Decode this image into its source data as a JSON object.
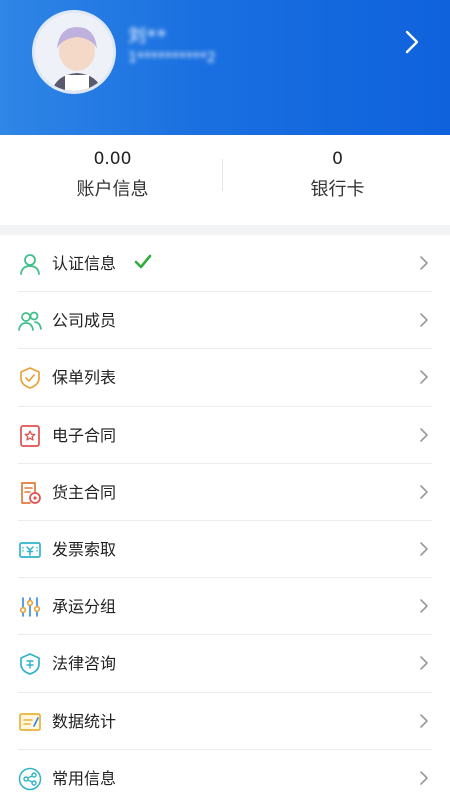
{
  "profile": {
    "name": "刘**",
    "phone": "1**********2"
  },
  "stats": [
    {
      "value": "0.00",
      "label": "账户信息"
    },
    {
      "value": "0",
      "label": "银行卡"
    }
  ],
  "menu": {
    "items": [
      {
        "label": "认证信息",
        "icon": "person-icon",
        "verified": true
      },
      {
        "label": "公司成员",
        "icon": "people-icon"
      },
      {
        "label": "保单列表",
        "icon": "shield-check-icon"
      },
      {
        "label": "电子合同",
        "icon": "contract-icon"
      },
      {
        "label": "货主合同",
        "icon": "cargo-contract-icon"
      },
      {
        "label": "发票索取",
        "icon": "invoice-icon"
      },
      {
        "label": "承运分组",
        "icon": "sliders-icon"
      },
      {
        "label": "法律咨询",
        "icon": "law-shield-icon"
      },
      {
        "label": "数据统计",
        "icon": "data-chart-icon"
      },
      {
        "label": "常用信息",
        "icon": "share-icon"
      }
    ]
  },
  "colors": {
    "header_blue": "#1a6fe0",
    "icon_green": "#3fbf8a",
    "icon_orange": "#e8a23a",
    "icon_red": "#e05050",
    "icon_teal": "#2fb3c9",
    "check_green": "#2fae3e"
  }
}
